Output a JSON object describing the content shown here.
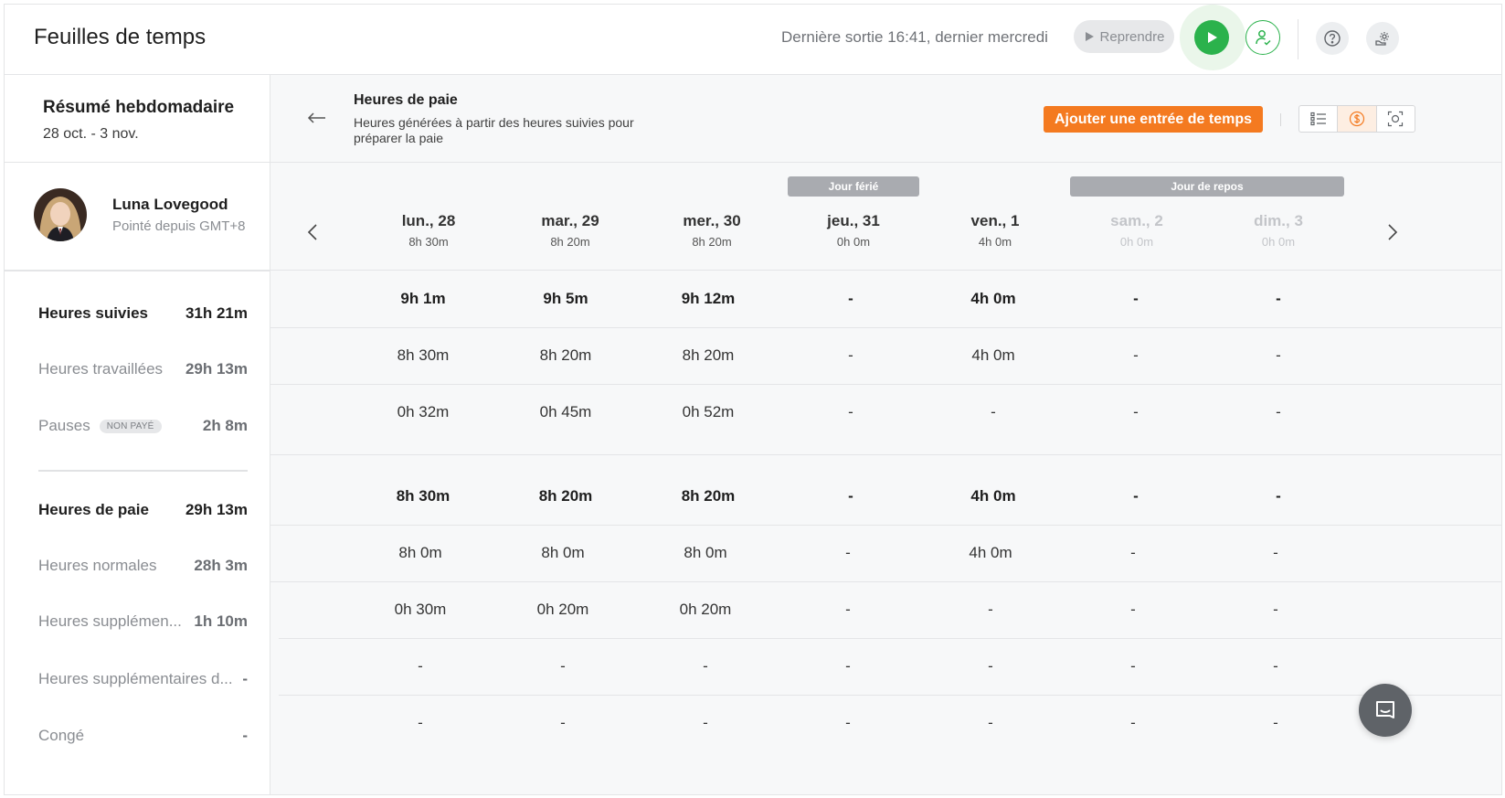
{
  "header": {
    "title": "Feuilles de temps",
    "last_out": "Dernière sortie 16:41, dernier mercredi",
    "resume_label": "Reprendre"
  },
  "weekly": {
    "title": "Résumé hebdomadaire",
    "range": "28 oct. - 3 nov."
  },
  "person": {
    "name": "Luna Lovegood",
    "timezone": "Pointé depuis GMT+8"
  },
  "summary": [
    {
      "label": "Heures suivies",
      "value": "31h 21m",
      "strong": true
    },
    {
      "label": "Heures travaillées",
      "value": "29h 13m",
      "strong": false
    },
    {
      "label": "Pauses",
      "badge": "NON PAYÉ",
      "value": "2h 8m",
      "strong": false
    },
    {
      "label": "Heures de paie",
      "value": "29h 13m",
      "strong": true
    },
    {
      "label": "Heures normales",
      "value": "28h 3m",
      "strong": false
    },
    {
      "label": "Heures supplémen...",
      "value": "1h 10m",
      "strong": false
    },
    {
      "label": "Heures supplémentaires d...",
      "value": "-",
      "strong": false
    },
    {
      "label": "Congé",
      "value": "-",
      "strong": false
    }
  ],
  "panel": {
    "title": "Heures de paie",
    "description": "Heures générées à partir des heures suivies pour préparer la paie",
    "add_entry": "Ajouter une entrée de temps"
  },
  "day_tags": {
    "holiday": "Jour férié",
    "rest": "Jour de repos"
  },
  "days": [
    {
      "name": "lun., 28",
      "hours": "8h 30m"
    },
    {
      "name": "mar., 29",
      "hours": "8h 20m"
    },
    {
      "name": "mer., 30",
      "hours": "8h 20m"
    },
    {
      "name": "jeu., 31",
      "hours": "0h 0m"
    },
    {
      "name": "ven., 1",
      "hours": "4h 0m"
    },
    {
      "name": "sam., 2",
      "hours": "0h 0m"
    },
    {
      "name": "dim., 3",
      "hours": "0h 0m"
    }
  ],
  "rows": [
    [
      "9h 1m",
      "9h 5m",
      "9h 12m",
      "-",
      "4h 0m",
      "-",
      "-"
    ],
    [
      "8h 30m",
      "8h 20m",
      "8h 20m",
      "-",
      "4h 0m",
      "-",
      "-"
    ],
    [
      "0h 32m",
      "0h 45m",
      "0h 52m",
      "-",
      "-",
      "-",
      "-"
    ],
    [
      "8h 30m",
      "8h 20m",
      "8h 20m",
      "-",
      "4h 0m",
      "-",
      "-"
    ],
    [
      "8h 0m",
      "8h 0m",
      "8h 0m",
      "-",
      "4h 0m",
      "-",
      "-"
    ],
    [
      "0h 30m",
      "0h 20m",
      "0h 20m",
      "-",
      "-",
      "-",
      "-"
    ],
    [
      "-",
      "-",
      "-",
      "-",
      "-",
      "-",
      "-"
    ],
    [
      "-",
      "-",
      "-",
      "-",
      "-",
      "-",
      "-"
    ]
  ],
  "colors": {
    "accent_orange": "#f47a20",
    "accent_green": "#2bb24c",
    "tag_gray": "#a9abb0"
  },
  "icons": [
    "play-icon",
    "user-check-icon",
    "help-icon",
    "settings-icon",
    "arrow-left-icon",
    "chevron-left-icon",
    "chevron-right-icon",
    "list-view-icon",
    "pay-view-icon",
    "capture-view-icon",
    "chat-icon"
  ]
}
